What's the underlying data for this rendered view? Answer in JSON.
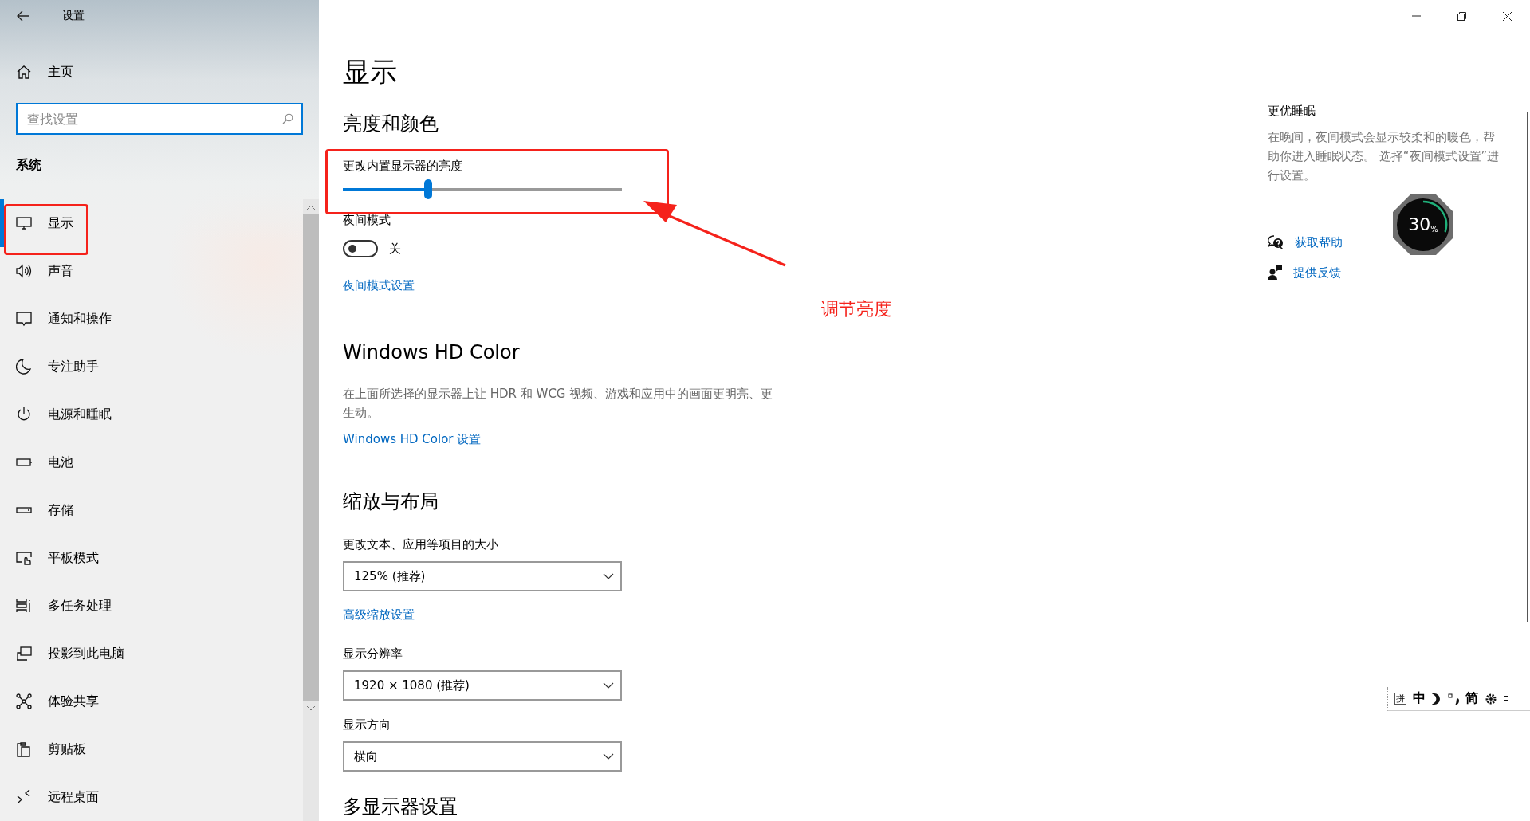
{
  "window": {
    "title": "设置"
  },
  "sidebar": {
    "home": "主页",
    "search": {
      "placeholder": "查找设置"
    },
    "section": "系统",
    "items": [
      {
        "label": "显示",
        "selected": true
      },
      {
        "label": "声音",
        "selected": false
      },
      {
        "label": "通知和操作",
        "selected": false
      },
      {
        "label": "专注助手",
        "selected": false
      },
      {
        "label": "电源和睡眠",
        "selected": false
      },
      {
        "label": "电池",
        "selected": false
      },
      {
        "label": "存储",
        "selected": false
      },
      {
        "label": "平板模式",
        "selected": false
      },
      {
        "label": "多任务处理",
        "selected": false
      },
      {
        "label": "投影到此电脑",
        "selected": false
      },
      {
        "label": "体验共享",
        "selected": false
      },
      {
        "label": "剪贴板",
        "selected": false
      },
      {
        "label": "远程桌面",
        "selected": false
      }
    ]
  },
  "page_title": "显示",
  "brightness": {
    "heading": "亮度和颜色",
    "slider_label": "更改内置显示器的亮度",
    "level": 0.307,
    "night_light": {
      "label": "夜间模式",
      "on": false,
      "state_text": "关"
    },
    "link": "夜间模式设置"
  },
  "hd_color": {
    "heading": "Windows HD Color",
    "description": "在上面所选择的显示器上让 HDR 和 WCG 视频、游戏和应用中的画面更明亮、更生动。",
    "link": "Windows HD Color 设置"
  },
  "scale_layout": {
    "heading": "缩放与布局",
    "fields": [
      {
        "label": "更改文本、应用等项目的大小",
        "value": "125% (推荐)"
      },
      {
        "label": "显示分辨率",
        "value": "1920 × 1080 (推荐)"
      },
      {
        "label": "显示方向",
        "value": "横向"
      }
    ],
    "link": "高级缩放设置"
  },
  "next_heading": "多显示器设置",
  "aside": {
    "title": "更优睡眠",
    "text": "在晚间，夜间模式会显示较柔和的暖色，帮助你进入睡眠状态。 选择“夜间模式设置”进行设置。",
    "links": [
      "获取帮助",
      "提供反馈"
    ]
  },
  "overlay_meter": {
    "value": "30",
    "unit": "%"
  },
  "annotation": {
    "label": "调节亮度"
  },
  "ime_bar": {
    "mode": "拼",
    "language": "中",
    "script": "简"
  }
}
